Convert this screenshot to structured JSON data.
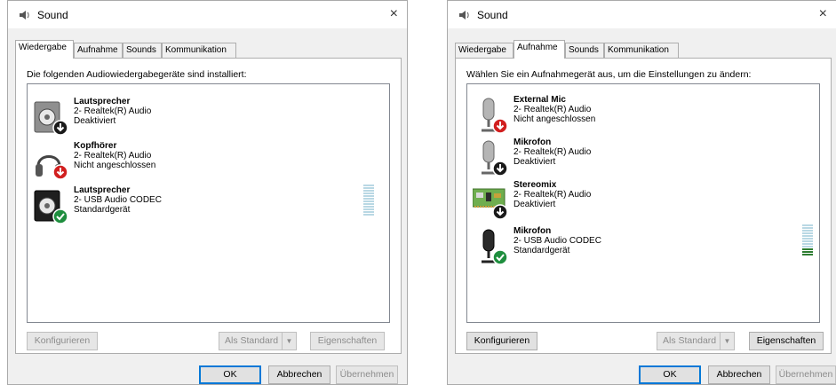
{
  "dialogs": [
    {
      "title": "Sound",
      "close_glyph": "×",
      "icon": "speaker-icon",
      "tabs": [
        {
          "label": "Wiedergabe",
          "active": true
        },
        {
          "label": "Aufnahme",
          "active": false
        },
        {
          "label": "Sounds",
          "active": false
        },
        {
          "label": "Kommunikation",
          "active": false
        }
      ],
      "instruction": "Die folgenden Audiowiedergabegeräte sind installiert:",
      "devices": [
        {
          "name": "Lautsprecher",
          "driver": "2- Realtek(R) Audio",
          "status": "Deaktiviert",
          "icon": "speaker-icon",
          "badge": "down-arrow-icon"
        },
        {
          "name": "Kopfhörer",
          "driver": "2- Realtek(R) Audio",
          "status": "Nicht angeschlossen",
          "icon": "headphones-icon",
          "badge": "red-down-arrow-icon"
        },
        {
          "name": "Lautsprecher",
          "driver": "2- USB Audio CODEC",
          "status": "Standardgerät",
          "icon": "speaker-icon",
          "badge": "green-check-icon"
        }
      ],
      "buttons": {
        "configure": "Konfigurieren",
        "set_default": "Als Standard",
        "split_arrow": "▼",
        "properties": "Eigenschaften",
        "ok": "OK",
        "cancel": "Abbrechen",
        "apply": "Übernehmen"
      },
      "level_meter": {
        "active_bars": 0
      }
    },
    {
      "title": "Sound",
      "close_glyph": "×",
      "icon": "speaker-icon",
      "tabs": [
        {
          "label": "Wiedergabe",
          "active": false
        },
        {
          "label": "Aufnahme",
          "active": true
        },
        {
          "label": "Sounds",
          "active": false
        },
        {
          "label": "Kommunikation",
          "active": false
        }
      ],
      "instruction": "Wählen Sie ein Aufnahmegerät aus, um die Einstellungen zu ändern:",
      "devices": [
        {
          "name": "External Mic",
          "driver": "2- Realtek(R) Audio",
          "status": "Nicht angeschlossen",
          "icon": "microphone-icon",
          "badge": "red-down-arrow-icon"
        },
        {
          "name": "Mikrofon",
          "driver": "2- Realtek(R) Audio",
          "status": "Deaktiviert",
          "icon": "microphone-icon",
          "badge": "down-arrow-icon"
        },
        {
          "name": "Stereomix",
          "driver": "2- Realtek(R) Audio",
          "status": "Deaktiviert",
          "icon": "sound-card-icon",
          "badge": "down-arrow-icon"
        },
        {
          "name": "Mikrofon",
          "driver": "2- USB Audio CODEC",
          "status": "Standardgerät",
          "icon": "microphone-icon",
          "badge": "green-check-icon"
        }
      ],
      "buttons": {
        "configure": "Konfigurieren",
        "set_default": "Als Standard",
        "split_arrow": "▼",
        "properties": "Eigenschaften",
        "ok": "OK",
        "cancel": "Abbrechen",
        "apply": "Übernehmen"
      },
      "level_meter": {
        "active_bars": 3
      }
    }
  ],
  "colors": {
    "accent": "#0078d7",
    "level_idle": "#b9d8e4",
    "level_active": "#2e7d32",
    "badge_green": "#1e8e3e",
    "badge_red": "#d11f1f",
    "badge_dark": "#1a1a1a"
  }
}
